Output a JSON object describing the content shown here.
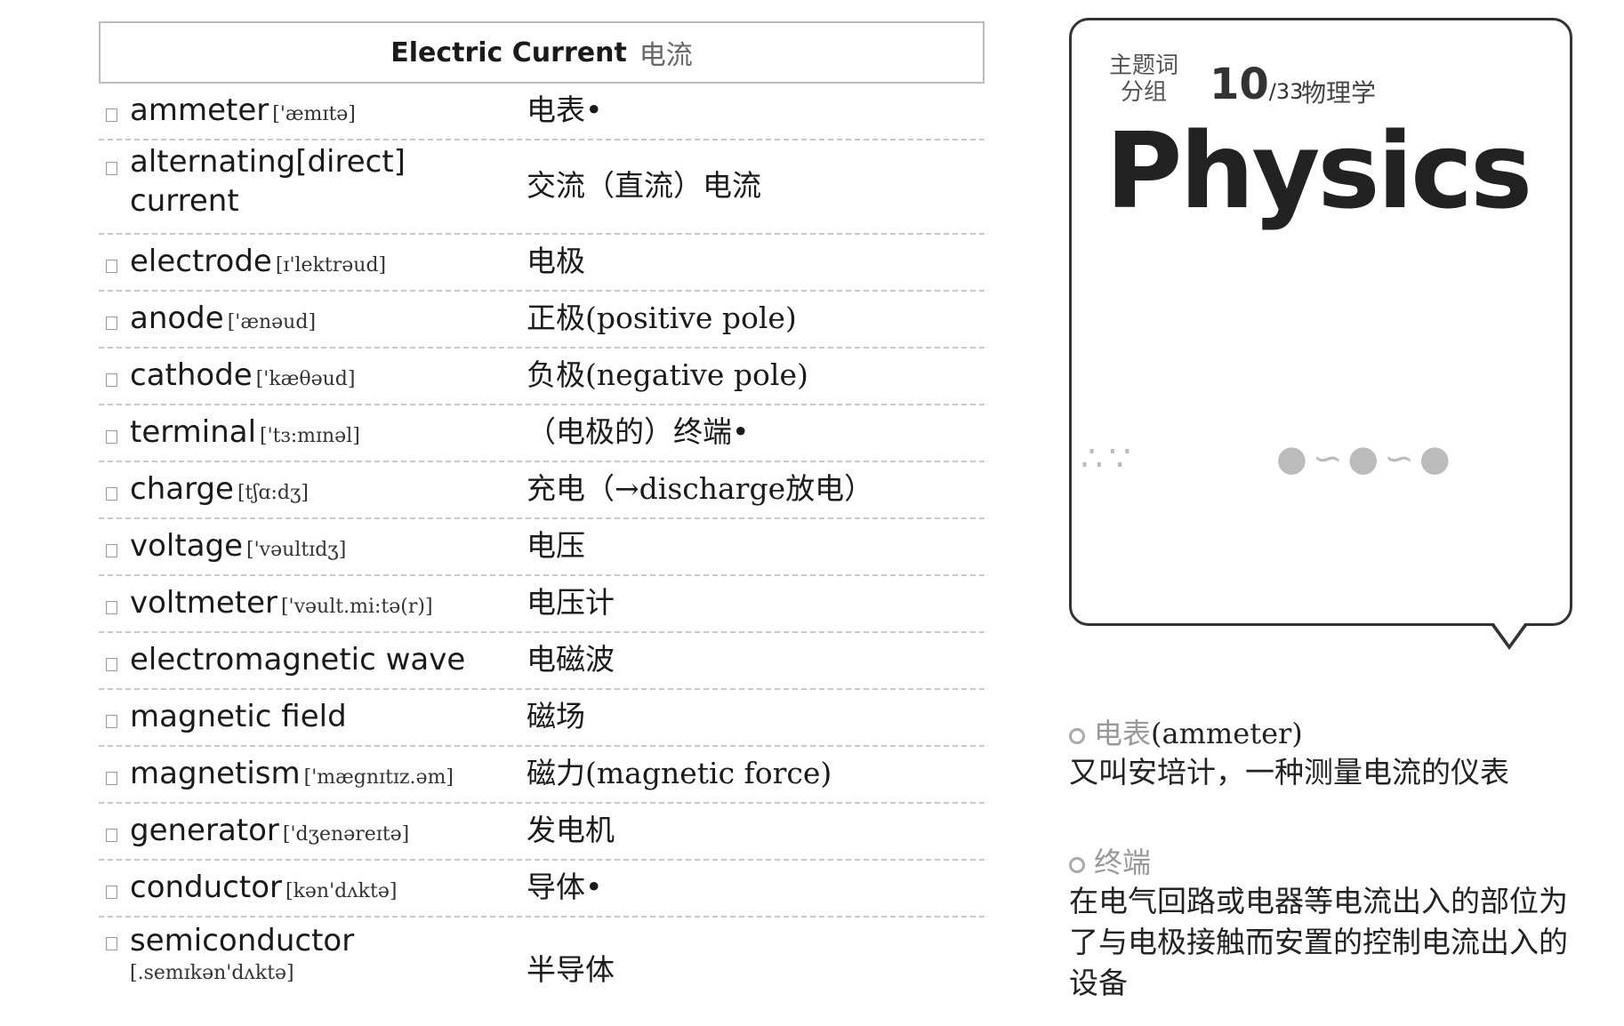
{
  "header": {
    "title_en": "Electric Current",
    "title_zh": "电流"
  },
  "entries": [
    {
      "term": "ammeter",
      "phonetic": "['æmɪtə]",
      "meaning": "电表•"
    },
    {
      "term": "alternating[direct] current",
      "phonetic": "",
      "meaning": "交流（直流）电流"
    },
    {
      "term": "electrode",
      "phonetic": "[ɪ'lektrəud]",
      "meaning": "电极"
    },
    {
      "term": "anode",
      "phonetic": "['ænəud]",
      "meaning": "正极(positive pole)"
    },
    {
      "term": "cathode",
      "phonetic": "['kæθəud]",
      "meaning": "负极(negative pole)"
    },
    {
      "term": "terminal",
      "phonetic": "['tɜ:mɪnəl]",
      "meaning": "（电极的）终端•"
    },
    {
      "term": "charge",
      "phonetic": "[tʃɑ:dʒ]",
      "meaning": "充电（→discharge放电）"
    },
    {
      "term": "voltage",
      "phonetic": "['vəultɪdʒ]",
      "meaning": "电压"
    },
    {
      "term": "voltmeter",
      "phonetic": "['vəult.mi:tə(r)]",
      "meaning": "电压计"
    },
    {
      "term": "electromagnetic wave",
      "phonetic": "",
      "meaning": "电磁波"
    },
    {
      "term": "magnetic field",
      "phonetic": "",
      "meaning": "磁场"
    },
    {
      "term": "magnetism",
      "phonetic": "['mægnɪtɪz.əm]",
      "meaning": "磁力(magnetic force)"
    },
    {
      "term": "generator",
      "phonetic": "['dʒenəreɪtə]",
      "meaning": "发电机"
    },
    {
      "term": "conductor",
      "phonetic": "[kən'dʌktə]",
      "meaning": "导体•"
    },
    {
      "term": "semiconductor",
      "phonetic": "[.semɪkən'dʌktə]",
      "meaning": "半导体"
    }
  ],
  "card": {
    "tag_line1": "主题词",
    "tag_line2": "分组",
    "number": "10",
    "total": "/33",
    "subject": "物理学",
    "title": "Physics"
  },
  "notes": [
    {
      "head_zh": "电表",
      "head_en": "(ammeter)",
      "body": "又叫安培计，一种测量电流的仪表"
    },
    {
      "head_zh": "终端",
      "head_en": "",
      "body": "在电气回路或电器等电流出入的部位为了与电极接触而安置的控制电流出入的设备"
    }
  ]
}
